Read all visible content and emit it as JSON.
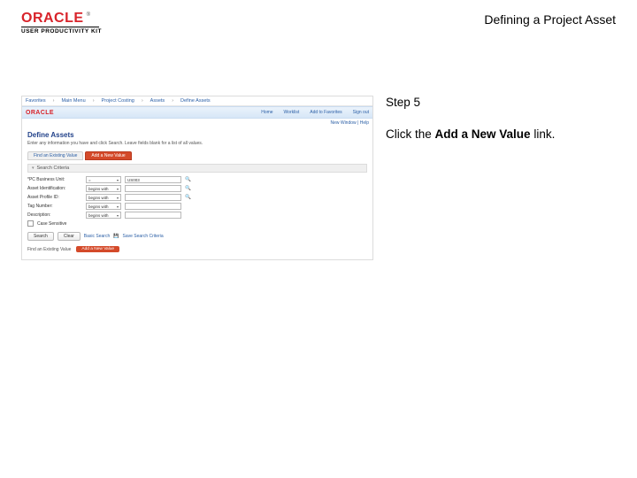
{
  "header": {
    "logo_text": "ORACLE",
    "logo_tm": "®",
    "upk_text": "USER PRODUCTIVITY KIT",
    "doc_title": "Defining a Project Asset"
  },
  "right_panel": {
    "step_label": "Step 5",
    "instruction_prefix": "Click the ",
    "instruction_bold": "Add a New Value",
    "instruction_suffix": " link."
  },
  "screenshot": {
    "breadcrumbs": [
      "Favorites",
      "Main Menu",
      "Project Costing",
      "Assets",
      "Define Assets"
    ],
    "crumb_sep": "›",
    "oracle_word": "ORACLE",
    "top_links": [
      "Home",
      "Worklist",
      "Add to Favorites",
      "Sign out"
    ],
    "menu_row": "New Window | Help",
    "page_title": "Define Assets",
    "page_sub": "Enter any information you have and click Search. Leave fields blank for a list of all values.",
    "tab_find": "Find an Existing Value",
    "tab_add": "Add a New Value",
    "criteria_header": "Search Criteria",
    "fields": {
      "bu": {
        "label": "*PC Business Unit:",
        "op": "=",
        "val": "US003"
      },
      "assetid": {
        "label": "Asset Identification:",
        "op": "begins with",
        "val": ""
      },
      "profile": {
        "label": "Asset Profile ID:",
        "op": "begins with",
        "val": ""
      },
      "tag": {
        "label": "Tag Number:",
        "op": "begins with",
        "val": ""
      },
      "desc": {
        "label": "Description:",
        "op": "begins with",
        "val": ""
      }
    },
    "case_sensitive": "Case Sensitive",
    "buttons": {
      "search": "Search",
      "clear": "Clear"
    },
    "basic_search": "Basic Search",
    "save_criteria": "Save Search Criteria",
    "footer_label": "Find an Existing Value",
    "footer_pill": "Add a New Value",
    "triangle": "▾",
    "lookup_icon": "🔍",
    "save_icon": "💾"
  }
}
